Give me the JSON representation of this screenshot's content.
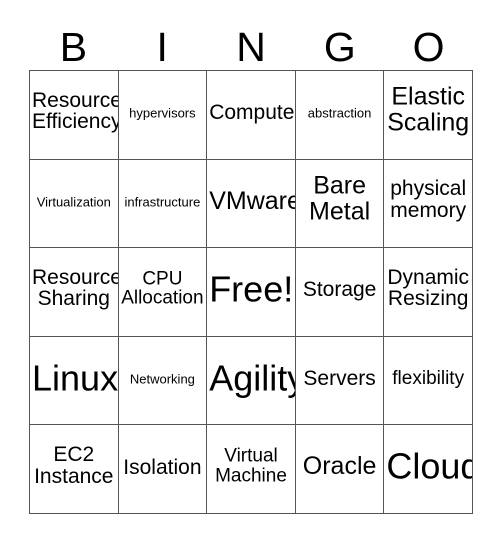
{
  "header": {
    "letters": [
      "B",
      "I",
      "N",
      "G",
      "O"
    ]
  },
  "grid": {
    "columns": 5,
    "rows": 5,
    "cells": [
      {
        "text": "Resource\nEfficiency",
        "size": "md"
      },
      {
        "text": "hypervisors",
        "size": "xxs"
      },
      {
        "text": "Compute",
        "size": "md"
      },
      {
        "text": "abstraction",
        "size": "xxs"
      },
      {
        "text": "Elastic\nScaling",
        "size": "lg"
      },
      {
        "text": "Virtualization",
        "size": "xxs"
      },
      {
        "text": "infrastructure",
        "size": "xxs"
      },
      {
        "text": "VMware",
        "size": "lg"
      },
      {
        "text": "Bare\nMetal",
        "size": "lg"
      },
      {
        "text": "physical\nmemory",
        "size": "md"
      },
      {
        "text": "Resource\nSharing",
        "size": "md"
      },
      {
        "text": "CPU\nAllocation",
        "size": "sm"
      },
      {
        "text": "Free!",
        "size": "xl"
      },
      {
        "text": "Storage",
        "size": "md"
      },
      {
        "text": "Dynamic\nResizing",
        "size": "md"
      },
      {
        "text": "Linux",
        "size": "xl"
      },
      {
        "text": "Networking",
        "size": "xxs"
      },
      {
        "text": "Agility",
        "size": "xl"
      },
      {
        "text": "Servers",
        "size": "md"
      },
      {
        "text": "flexibility",
        "size": "sm"
      },
      {
        "text": "EC2\nInstance",
        "size": "md"
      },
      {
        "text": "Isolation",
        "size": "md"
      },
      {
        "text": "Virtual\nMachine",
        "size": "sm"
      },
      {
        "text": "Oracle",
        "size": "lg"
      },
      {
        "text": "Cloud",
        "size": "xl"
      }
    ]
  },
  "colors": {
    "background": "#ffffff",
    "text": "#000000",
    "grid_line": "#555555"
  }
}
